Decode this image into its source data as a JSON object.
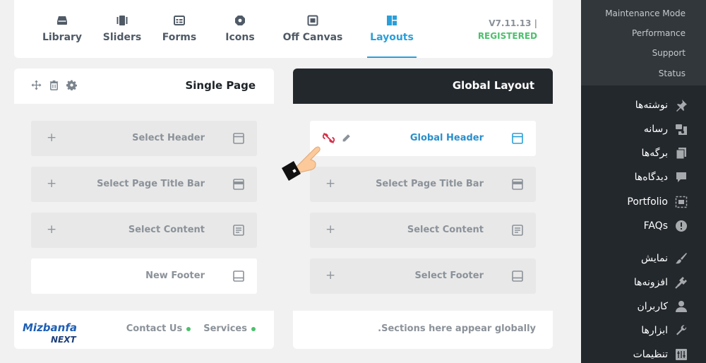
{
  "tabs": [
    {
      "label": "Library",
      "icon": "library-icon"
    },
    {
      "label": "Sliders",
      "icon": "sliders-icon"
    },
    {
      "label": "Forms",
      "icon": "forms-icon"
    },
    {
      "label": "Icons",
      "icon": "icons-icon"
    },
    {
      "label": "Off Canvas",
      "icon": "off-canvas-icon"
    },
    {
      "label": "Layouts",
      "icon": "layouts-icon",
      "active": true
    }
  ],
  "version": {
    "number": "V7.11.13 |",
    "status": "REGISTERED"
  },
  "single_page": {
    "title": "Single Page",
    "rows": [
      {
        "label": "Select Header",
        "plus": "+"
      },
      {
        "label": "Select Page Title Bar",
        "plus": "+"
      },
      {
        "label": "Select Content",
        "plus": "+"
      },
      {
        "label": "New Footer"
      }
    ],
    "footer_links": [
      "Contact Us",
      "Services"
    ]
  },
  "global_layout": {
    "title": "Global Layout",
    "rows": [
      {
        "label": "Global Header"
      },
      {
        "label": "Select Page Title Bar",
        "plus": "+"
      },
      {
        "label": "Select Content",
        "plus": "+"
      },
      {
        "label": "Select Footer",
        "plus": "+"
      }
    ],
    "footer_note": ".Sections here appear globally"
  },
  "sidebar": {
    "submenu": [
      "Maintenance Mode",
      "Performance",
      "Support",
      "Status"
    ],
    "items": [
      {
        "label": "نوشته‌ها",
        "icon": "pin-icon"
      },
      {
        "label": "رسانه",
        "icon": "media-icon"
      },
      {
        "label": "برگه‌ها",
        "icon": "pages-icon"
      },
      {
        "label": "دیدگاه‌ها",
        "icon": "comments-icon"
      },
      {
        "label": "Portfolio",
        "icon": "portfolio-icon"
      },
      {
        "label": "FAQs",
        "icon": "faq-icon"
      },
      {
        "label": "نمایش",
        "icon": "brush-icon"
      },
      {
        "label": "افزونه‌ها",
        "icon": "plugin-icon"
      },
      {
        "label": "کاربران",
        "icon": "user-icon"
      },
      {
        "label": "ابزارها",
        "icon": "wrench-icon"
      },
      {
        "label": "تنظیمات",
        "icon": "settings-icon"
      }
    ]
  },
  "logo": {
    "line1": "Mizbanfa",
    "line2": "NEXT"
  },
  "colors": {
    "accent": "#2a9fd9",
    "registered": "#4cc06c",
    "dark": "#23282d",
    "unlink": "#d6304a"
  }
}
